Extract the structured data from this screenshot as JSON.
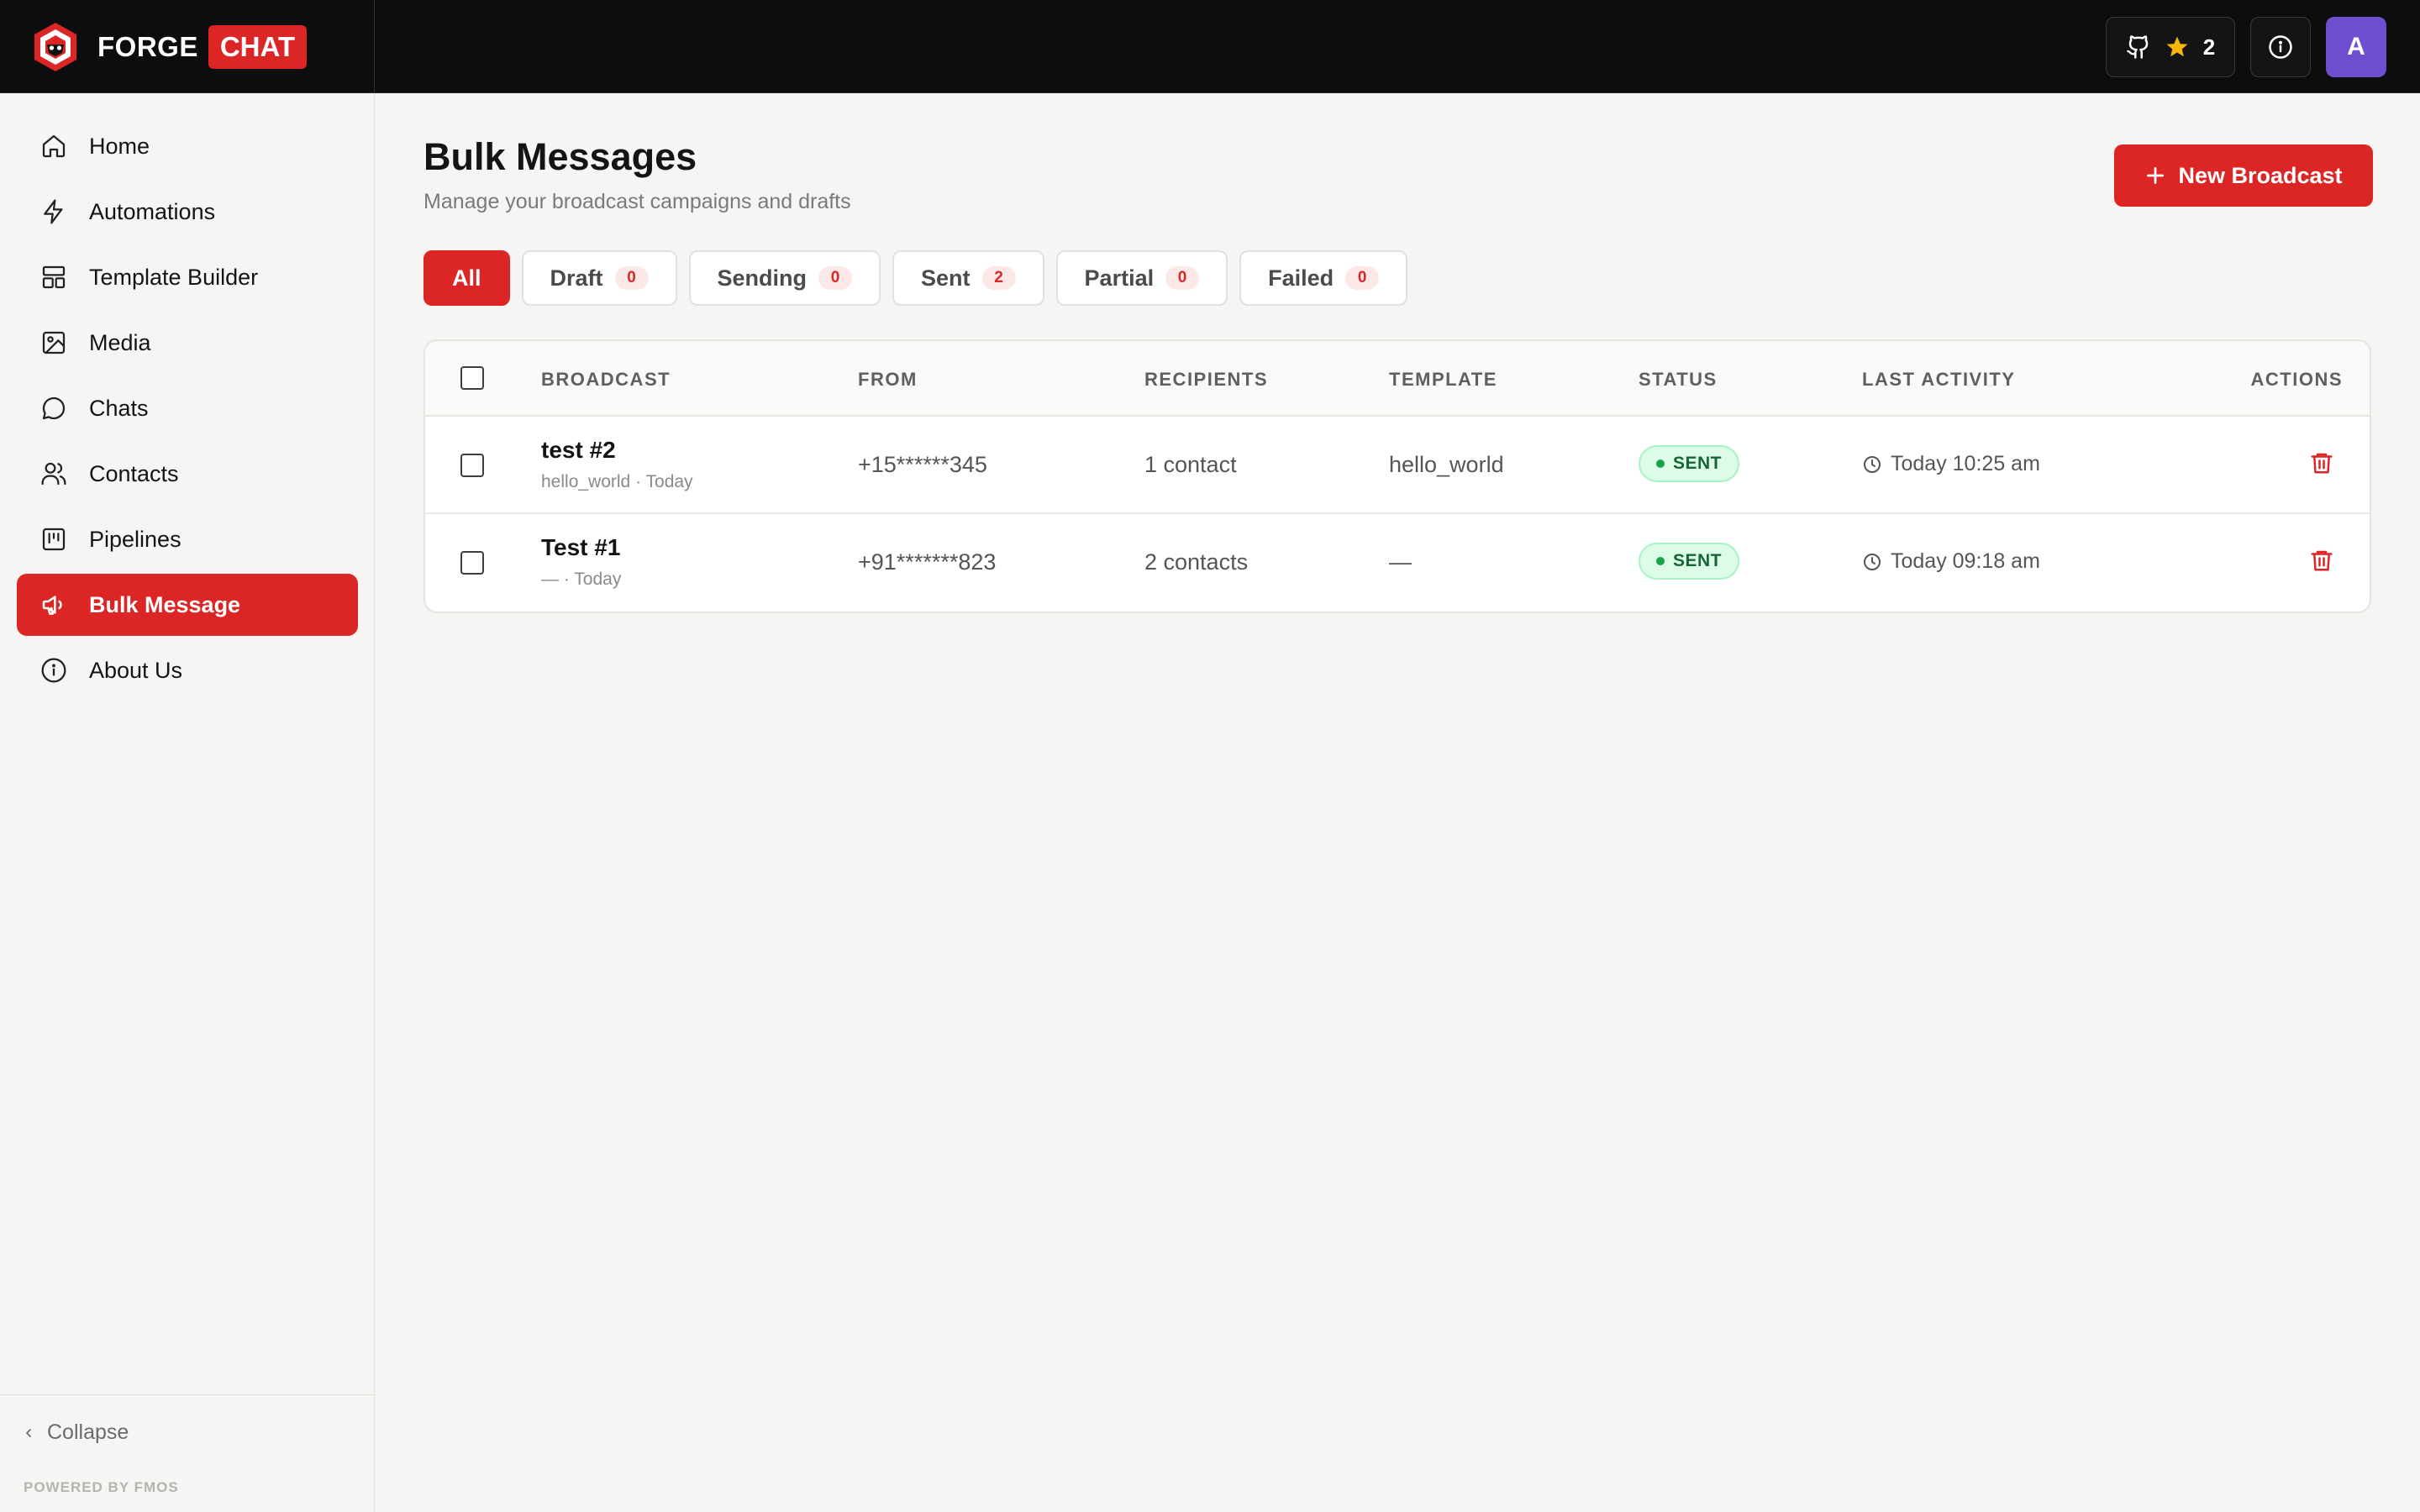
{
  "brand": {
    "name_left": "FORGE",
    "name_right": "CHAT"
  },
  "header": {
    "github_stars": "2"
  },
  "user": {
    "avatar_initial": "A"
  },
  "sidebar": {
    "items": [
      {
        "label": "Home",
        "icon": "home-icon"
      },
      {
        "label": "Automations",
        "icon": "bolt-icon"
      },
      {
        "label": "Template Builder",
        "icon": "layout-icon"
      },
      {
        "label": "Media",
        "icon": "image-icon"
      },
      {
        "label": "Chats",
        "icon": "chat-bubble-icon"
      },
      {
        "label": "Contacts",
        "icon": "users-icon"
      },
      {
        "label": "Pipelines",
        "icon": "kanban-icon"
      },
      {
        "label": "Bulk Message",
        "icon": "megaphone-icon",
        "active": true
      },
      {
        "label": "About Us",
        "icon": "info-icon"
      }
    ],
    "collapse_label": "Collapse",
    "powered_by": "POWERED BY FMOS"
  },
  "page": {
    "title": "Bulk Messages",
    "subtitle": "Manage your broadcast campaigns and drafts",
    "new_button_label": "New Broadcast"
  },
  "tabs": [
    {
      "label": "All",
      "active": true
    },
    {
      "label": "Draft",
      "count": "0"
    },
    {
      "label": "Sending",
      "count": "0"
    },
    {
      "label": "Sent",
      "count": "2"
    },
    {
      "label": "Partial",
      "count": "0"
    },
    {
      "label": "Failed",
      "count": "0"
    }
  ],
  "table": {
    "headers": {
      "broadcast": "BROADCAST",
      "from": "FROM",
      "recipients": "RECIPIENTS",
      "template": "TEMPLATE",
      "status": "STATUS",
      "last_activity": "LAST ACTIVITY",
      "actions": "ACTIONS"
    },
    "rows": [
      {
        "name": "test #2",
        "sub": "hello_world · Today",
        "from": "+15******345",
        "recipients": "1 contact",
        "template": "hello_world",
        "status": "SENT",
        "last_activity": "Today 10:25 am"
      },
      {
        "name": "Test #1",
        "sub": "— · Today",
        "from": "+91*******823",
        "recipients": "2 contacts",
        "template": "—",
        "status": "SENT",
        "last_activity": "Today 09:18 am"
      }
    ]
  },
  "colors": {
    "accent": "#dc2626",
    "topbar": "#0d0d0d",
    "status_sent_bg": "#dcfce7",
    "status_sent_text": "#166534",
    "avatar": "#6d4fd0",
    "star": "#f5b50a"
  }
}
